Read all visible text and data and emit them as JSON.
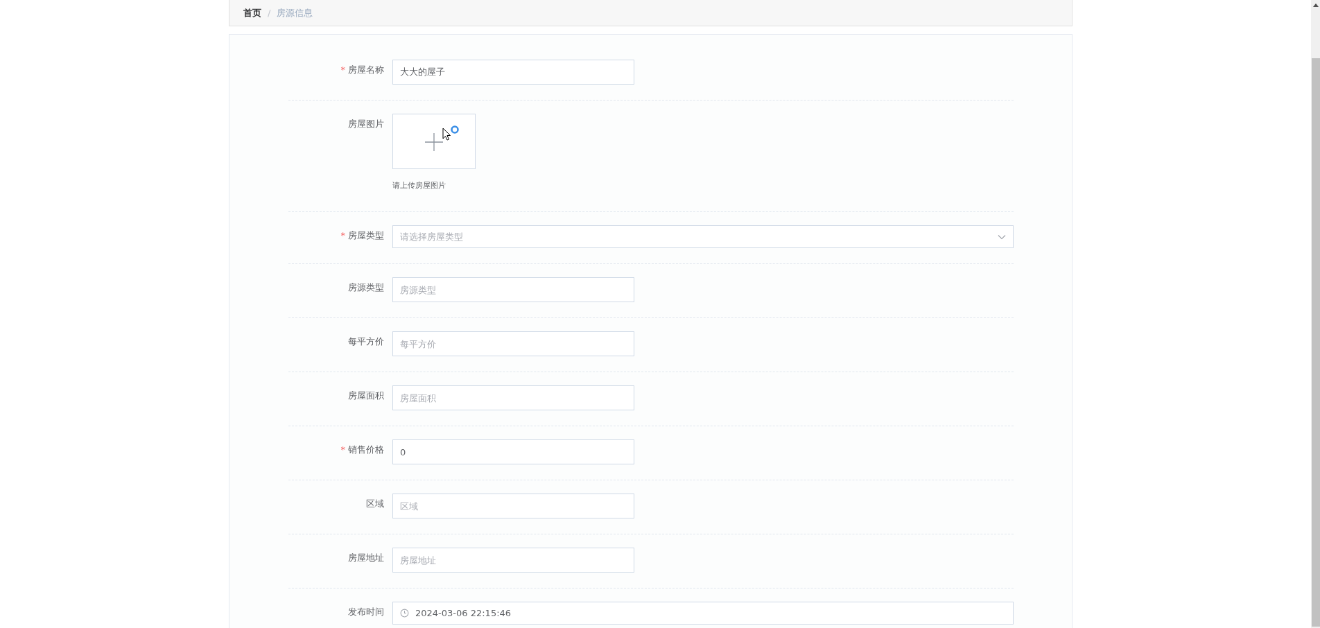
{
  "breadcrumb": {
    "separator": "/",
    "items": [
      {
        "label": "首页",
        "current": false
      },
      {
        "label": "房源信息",
        "current": true
      }
    ]
  },
  "form": {
    "required_mark": "*",
    "fields": [
      {
        "kind": "input",
        "label": "房屋名称",
        "required": true,
        "value": "大大的屋子"
      },
      {
        "kind": "upload",
        "label": "房屋图片",
        "required": false,
        "hint": "请上传房屋图片"
      },
      {
        "kind": "select",
        "label": "房屋类型",
        "required": true,
        "placeholder": "请选择房屋类型"
      },
      {
        "kind": "input",
        "label": "房源类型",
        "required": false,
        "placeholder": "房源类型"
      },
      {
        "kind": "input",
        "label": "每平方价",
        "required": false,
        "placeholder": "每平方价"
      },
      {
        "kind": "input",
        "label": "房屋面积",
        "required": false,
        "placeholder": "房屋面积"
      },
      {
        "kind": "input",
        "label": "销售价格",
        "required": true,
        "value": "0"
      },
      {
        "kind": "input",
        "label": "区域",
        "required": false,
        "placeholder": "区域"
      },
      {
        "kind": "input",
        "label": "房屋地址",
        "required": false,
        "placeholder": "房屋地址"
      },
      {
        "kind": "datetime",
        "label": "发布时间",
        "required": false,
        "value": "2024-03-06 22:15:46"
      }
    ]
  }
}
